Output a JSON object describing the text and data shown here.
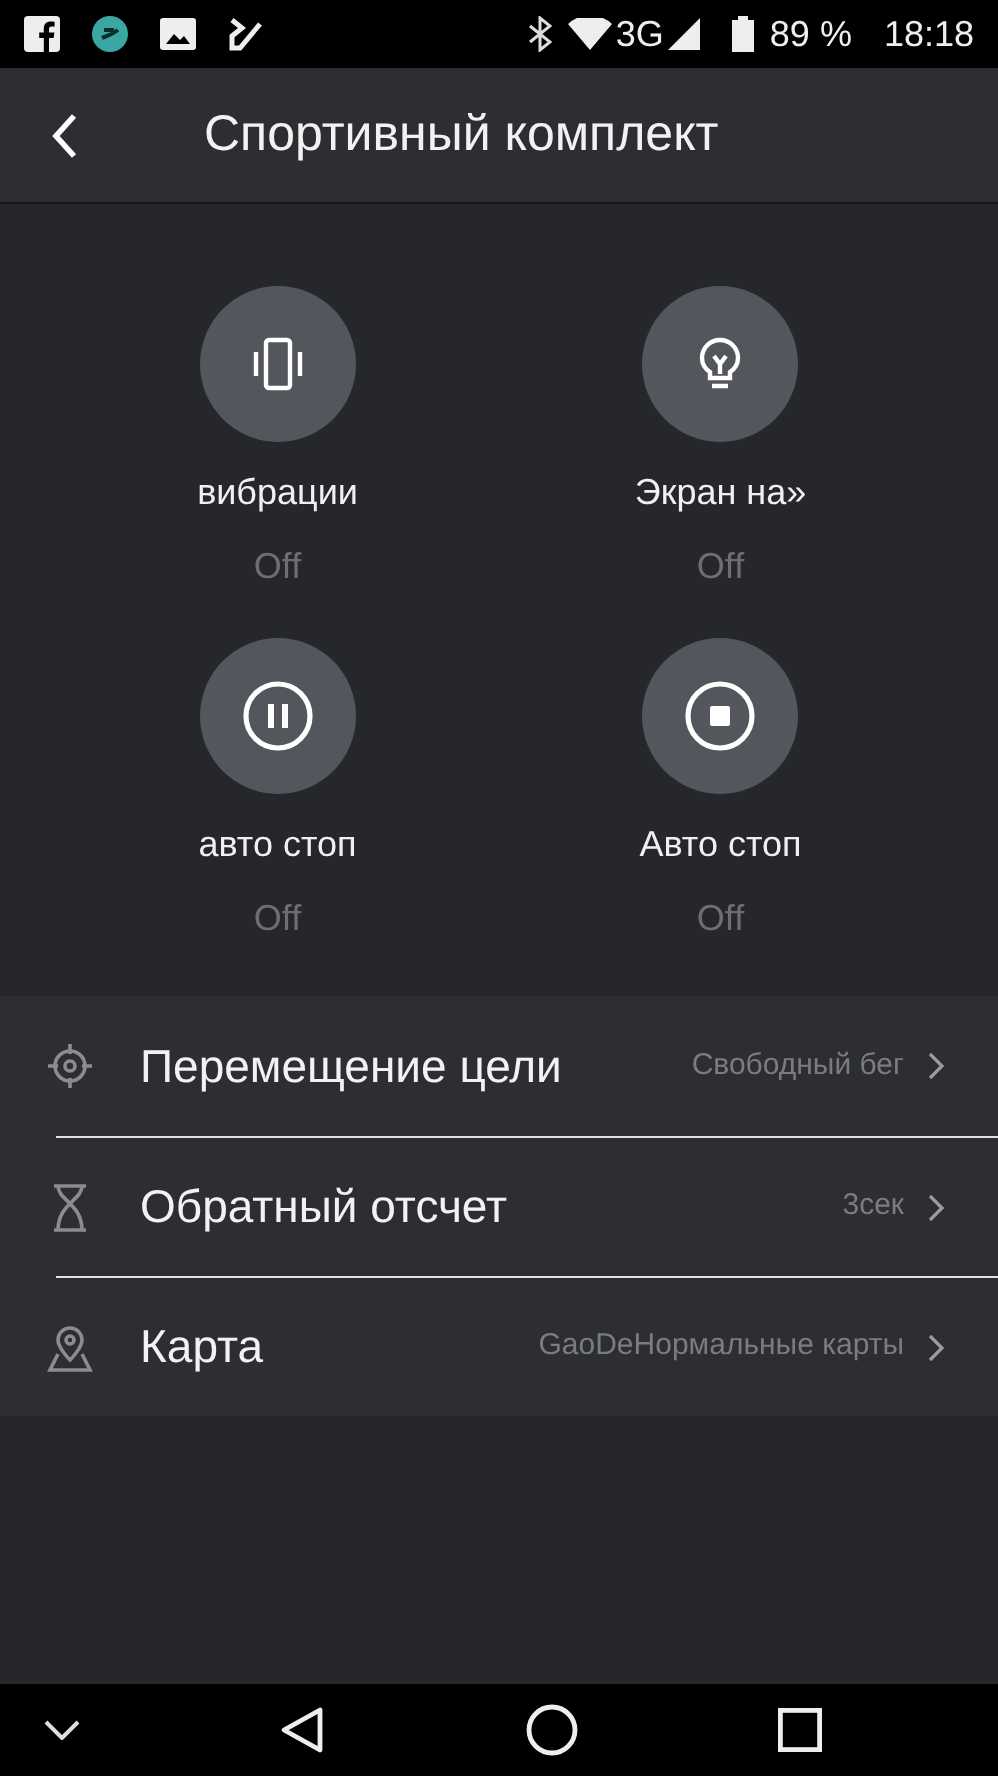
{
  "status_bar": {
    "network": "3G",
    "battery": "89 %",
    "time": "18:18"
  },
  "header": {
    "title": "Спортивный комплект"
  },
  "toggles": [
    {
      "kind": "vibration",
      "label": "вибрации",
      "value": "Off"
    },
    {
      "kind": "bulb",
      "label": "Экран на»",
      "value": "Off"
    },
    {
      "kind": "pause",
      "label": "авто стоп",
      "value": "Off"
    },
    {
      "kind": "stop",
      "label": "Авто стоп",
      "value": "Off"
    }
  ],
  "settings": [
    {
      "kind": "target",
      "label": "Перемещение цели",
      "value": "Свободный бег"
    },
    {
      "kind": "timer",
      "label": "Обратный отсчет",
      "value": "3сек"
    },
    {
      "kind": "map",
      "label": "Карта",
      "value": "GaoDeНормальные карты"
    }
  ]
}
